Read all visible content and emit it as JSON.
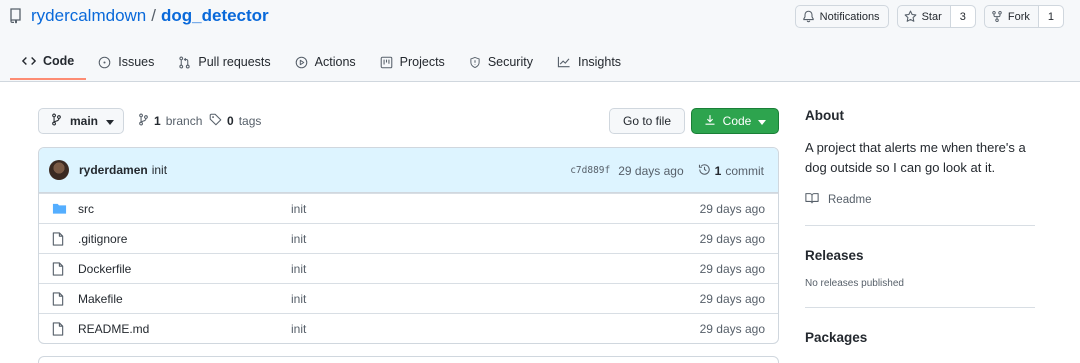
{
  "repo": {
    "owner": "rydercalmdown",
    "separator": "/",
    "name": "dog_detector"
  },
  "actions": {
    "notifications_label": "Notifications",
    "star_label": "Star",
    "star_count": "3",
    "fork_label": "Fork",
    "fork_count": "1"
  },
  "tabs": [
    {
      "label": "Code",
      "icon": "code-icon"
    },
    {
      "label": "Issues",
      "icon": "issue-icon"
    },
    {
      "label": "Pull requests",
      "icon": "pull-request-icon"
    },
    {
      "label": "Actions",
      "icon": "play-icon"
    },
    {
      "label": "Projects",
      "icon": "project-icon"
    },
    {
      "label": "Security",
      "icon": "shield-icon"
    },
    {
      "label": "Insights",
      "icon": "graph-icon"
    }
  ],
  "branch": {
    "current": "main",
    "branch_count": "1",
    "branch_word": "branch",
    "tag_count": "0",
    "tag_word": "tags",
    "goto_label": "Go to file",
    "code_label": "Code"
  },
  "commit": {
    "author": "ryderdamen",
    "message": "init",
    "sha": "c7d889f",
    "age": "29 days ago",
    "count": "1",
    "count_word": "commit"
  },
  "files": [
    {
      "name": "src",
      "type": "folder",
      "message": "init",
      "age": "29 days ago"
    },
    {
      "name": ".gitignore",
      "type": "file",
      "message": "init",
      "age": "29 days ago"
    },
    {
      "name": "Dockerfile",
      "type": "file",
      "message": "init",
      "age": "29 days ago"
    },
    {
      "name": "Makefile",
      "type": "file",
      "message": "init",
      "age": "29 days ago"
    },
    {
      "name": "README.md",
      "type": "file",
      "message": "init",
      "age": "29 days ago"
    }
  ],
  "sidebar": {
    "about_heading": "About",
    "about_description": "A project that alerts me when there's a dog outside so I can go look at it.",
    "readme_label": "Readme",
    "releases_heading": "Releases",
    "releases_empty": "No releases published",
    "packages_heading": "Packages"
  },
  "colors": {
    "link": "#0969da",
    "primary_button": "#2da44e",
    "active_tab_underline": "#fd8c73",
    "commit_row_bg": "#ddf4ff",
    "folder_icon": "#54aeff"
  }
}
